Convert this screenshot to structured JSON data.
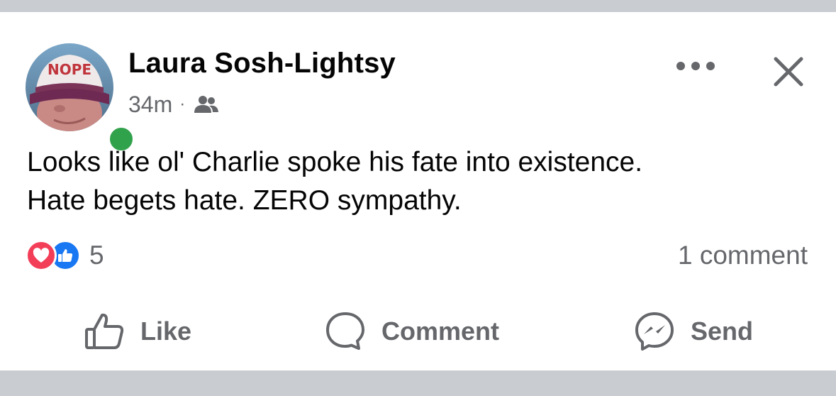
{
  "post": {
    "author": {
      "name": "Laura Sosh-Lightsy",
      "avatar_hat_text": "NOPE",
      "online": true
    },
    "meta": {
      "time": "34m",
      "separator": "·",
      "audience_icon": "friends-icon"
    },
    "body_lines": [
      "Looks like ol' Charlie spoke his fate into existence.",
      "Hate begets hate. ZERO sympathy."
    ],
    "reactions": {
      "types": [
        "love-reaction-icon",
        "like-reaction-icon"
      ],
      "count": "5"
    },
    "comments_label": "1 comment",
    "actions": {
      "like": "Like",
      "comment": "Comment",
      "send": "Send"
    }
  },
  "colors": {
    "text_primary": "#050505",
    "text_secondary": "#65676b",
    "online": "#31a24c",
    "love": "#f33e58",
    "like": "#1877f2",
    "divider": "#c9ccd1"
  }
}
